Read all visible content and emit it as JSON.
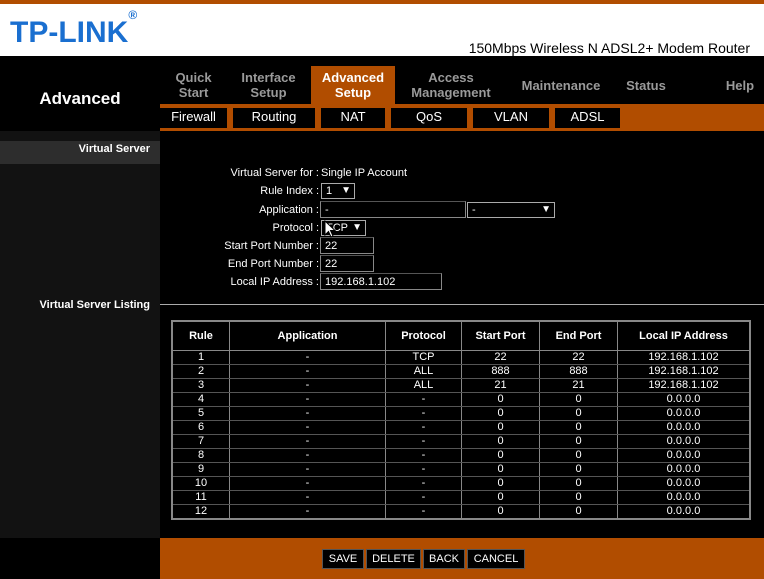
{
  "header": {
    "logo": "TP-LINK",
    "logo_mark": "®",
    "product": "150Mbps Wireless N ADSL2+ Modem Router"
  },
  "sidebar": {
    "title": "Advanced",
    "section1": "Virtual Server",
    "section2": "Virtual Server Listing"
  },
  "nav": {
    "tabs": [
      {
        "l1": "Quick",
        "l2": "Start"
      },
      {
        "l1": "Interface",
        "l2": "Setup"
      },
      {
        "l1": "Advanced",
        "l2": "Setup"
      },
      {
        "l1": "Access",
        "l2": "Management"
      },
      {
        "l1": "Maintenance",
        "l2": ""
      },
      {
        "l1": "Status",
        "l2": ""
      },
      {
        "l1": "Help",
        "l2": ""
      }
    ],
    "active": "Advanced Setup"
  },
  "subnav": [
    "Firewall",
    "Routing",
    "NAT",
    "QoS",
    "VLAN",
    "ADSL"
  ],
  "form": {
    "virtual_server_for_label": "Virtual Server for :",
    "virtual_server_for_value": "Single IP Account",
    "rule_index_label": "Rule Index :",
    "rule_index_value": "1",
    "application_label": "Application :",
    "application_value": "-",
    "application_select": "-",
    "protocol_label": "Protocol :",
    "protocol_value": "TCP",
    "start_port_label": "Start Port Number :",
    "start_port_value": "22",
    "end_port_label": "End Port Number :",
    "end_port_value": "22",
    "local_ip_label": "Local IP Address :",
    "local_ip_value": "192.168.1.102"
  },
  "table": {
    "headers": [
      "Rule",
      "Application",
      "Protocol",
      "Start Port",
      "End Port",
      "Local IP Address"
    ],
    "rows": [
      [
        "1",
        "-",
        "TCP",
        "22",
        "22",
        "192.168.1.102"
      ],
      [
        "2",
        "-",
        "ALL",
        "888",
        "888",
        "192.168.1.102"
      ],
      [
        "3",
        "-",
        "ALL",
        "21",
        "21",
        "192.168.1.102"
      ],
      [
        "4",
        "-",
        "-",
        "0",
        "0",
        "0.0.0.0"
      ],
      [
        "5",
        "-",
        "-",
        "0",
        "0",
        "0.0.0.0"
      ],
      [
        "6",
        "-",
        "-",
        "0",
        "0",
        "0.0.0.0"
      ],
      [
        "7",
        "-",
        "-",
        "0",
        "0",
        "0.0.0.0"
      ],
      [
        "8",
        "-",
        "-",
        "0",
        "0",
        "0.0.0.0"
      ],
      [
        "9",
        "-",
        "-",
        "0",
        "0",
        "0.0.0.0"
      ],
      [
        "10",
        "-",
        "-",
        "0",
        "0",
        "0.0.0.0"
      ],
      [
        "11",
        "-",
        "-",
        "0",
        "0",
        "0.0.0.0"
      ],
      [
        "12",
        "-",
        "-",
        "0",
        "0",
        "0.0.0.0"
      ]
    ]
  },
  "buttons": {
    "save": "SAVE",
    "delete": "DELETE",
    "back": "BACK",
    "cancel": "CANCEL"
  },
  "colors": {
    "accent": "#b14d00",
    "logo_blue": "#1a6fd0"
  }
}
